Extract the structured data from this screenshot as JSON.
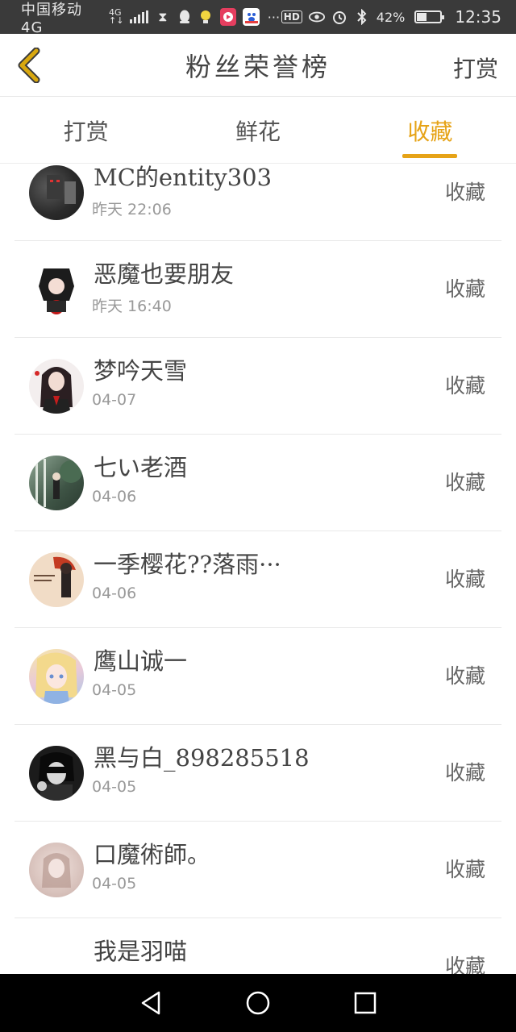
{
  "status_bar": {
    "carrier": "中国移动4G",
    "network_top": "4G",
    "network_bottom": "↑↓",
    "hd": "HD",
    "battery_text": "42%",
    "battery_level": 0.42,
    "time": "12:35"
  },
  "header": {
    "title": "粉丝荣誉榜",
    "right_link": "打赏"
  },
  "tabs": [
    {
      "label": "打赏",
      "active": false
    },
    {
      "label": "鲜花",
      "active": false
    },
    {
      "label": "收藏",
      "active": true
    }
  ],
  "list": [
    {
      "name": "MC的entity303",
      "time": "昨天 22:06",
      "action": "收藏"
    },
    {
      "name": "恶魔也要朋友",
      "time": "昨天 16:40",
      "action": "收藏"
    },
    {
      "name": "梦吟天雪",
      "time": "04-07",
      "action": "收藏"
    },
    {
      "name": "七い老酒",
      "time": "04-06",
      "action": "收藏"
    },
    {
      "name": "一季樱花??落雨···",
      "time": "04-06",
      "action": "收藏"
    },
    {
      "name": "鹰山诚一",
      "time": "04-05",
      "action": "收藏"
    },
    {
      "name": "黑与白_898285518",
      "time": "04-05",
      "action": "收藏"
    },
    {
      "name": "口魔術師。",
      "time": "04-05",
      "action": "收藏"
    },
    {
      "name": "我是羽喵",
      "time": "",
      "action": "收藏"
    }
  ],
  "colors": {
    "accent": "#e6a317",
    "status_bar": "#3a3a3a",
    "back_arrow": "#d9a80f"
  },
  "icons": {
    "back": "chevron-left-icon",
    "nav_back": "triangle-back-icon",
    "nav_home": "circle-home-icon",
    "nav_recents": "square-recents-icon"
  }
}
